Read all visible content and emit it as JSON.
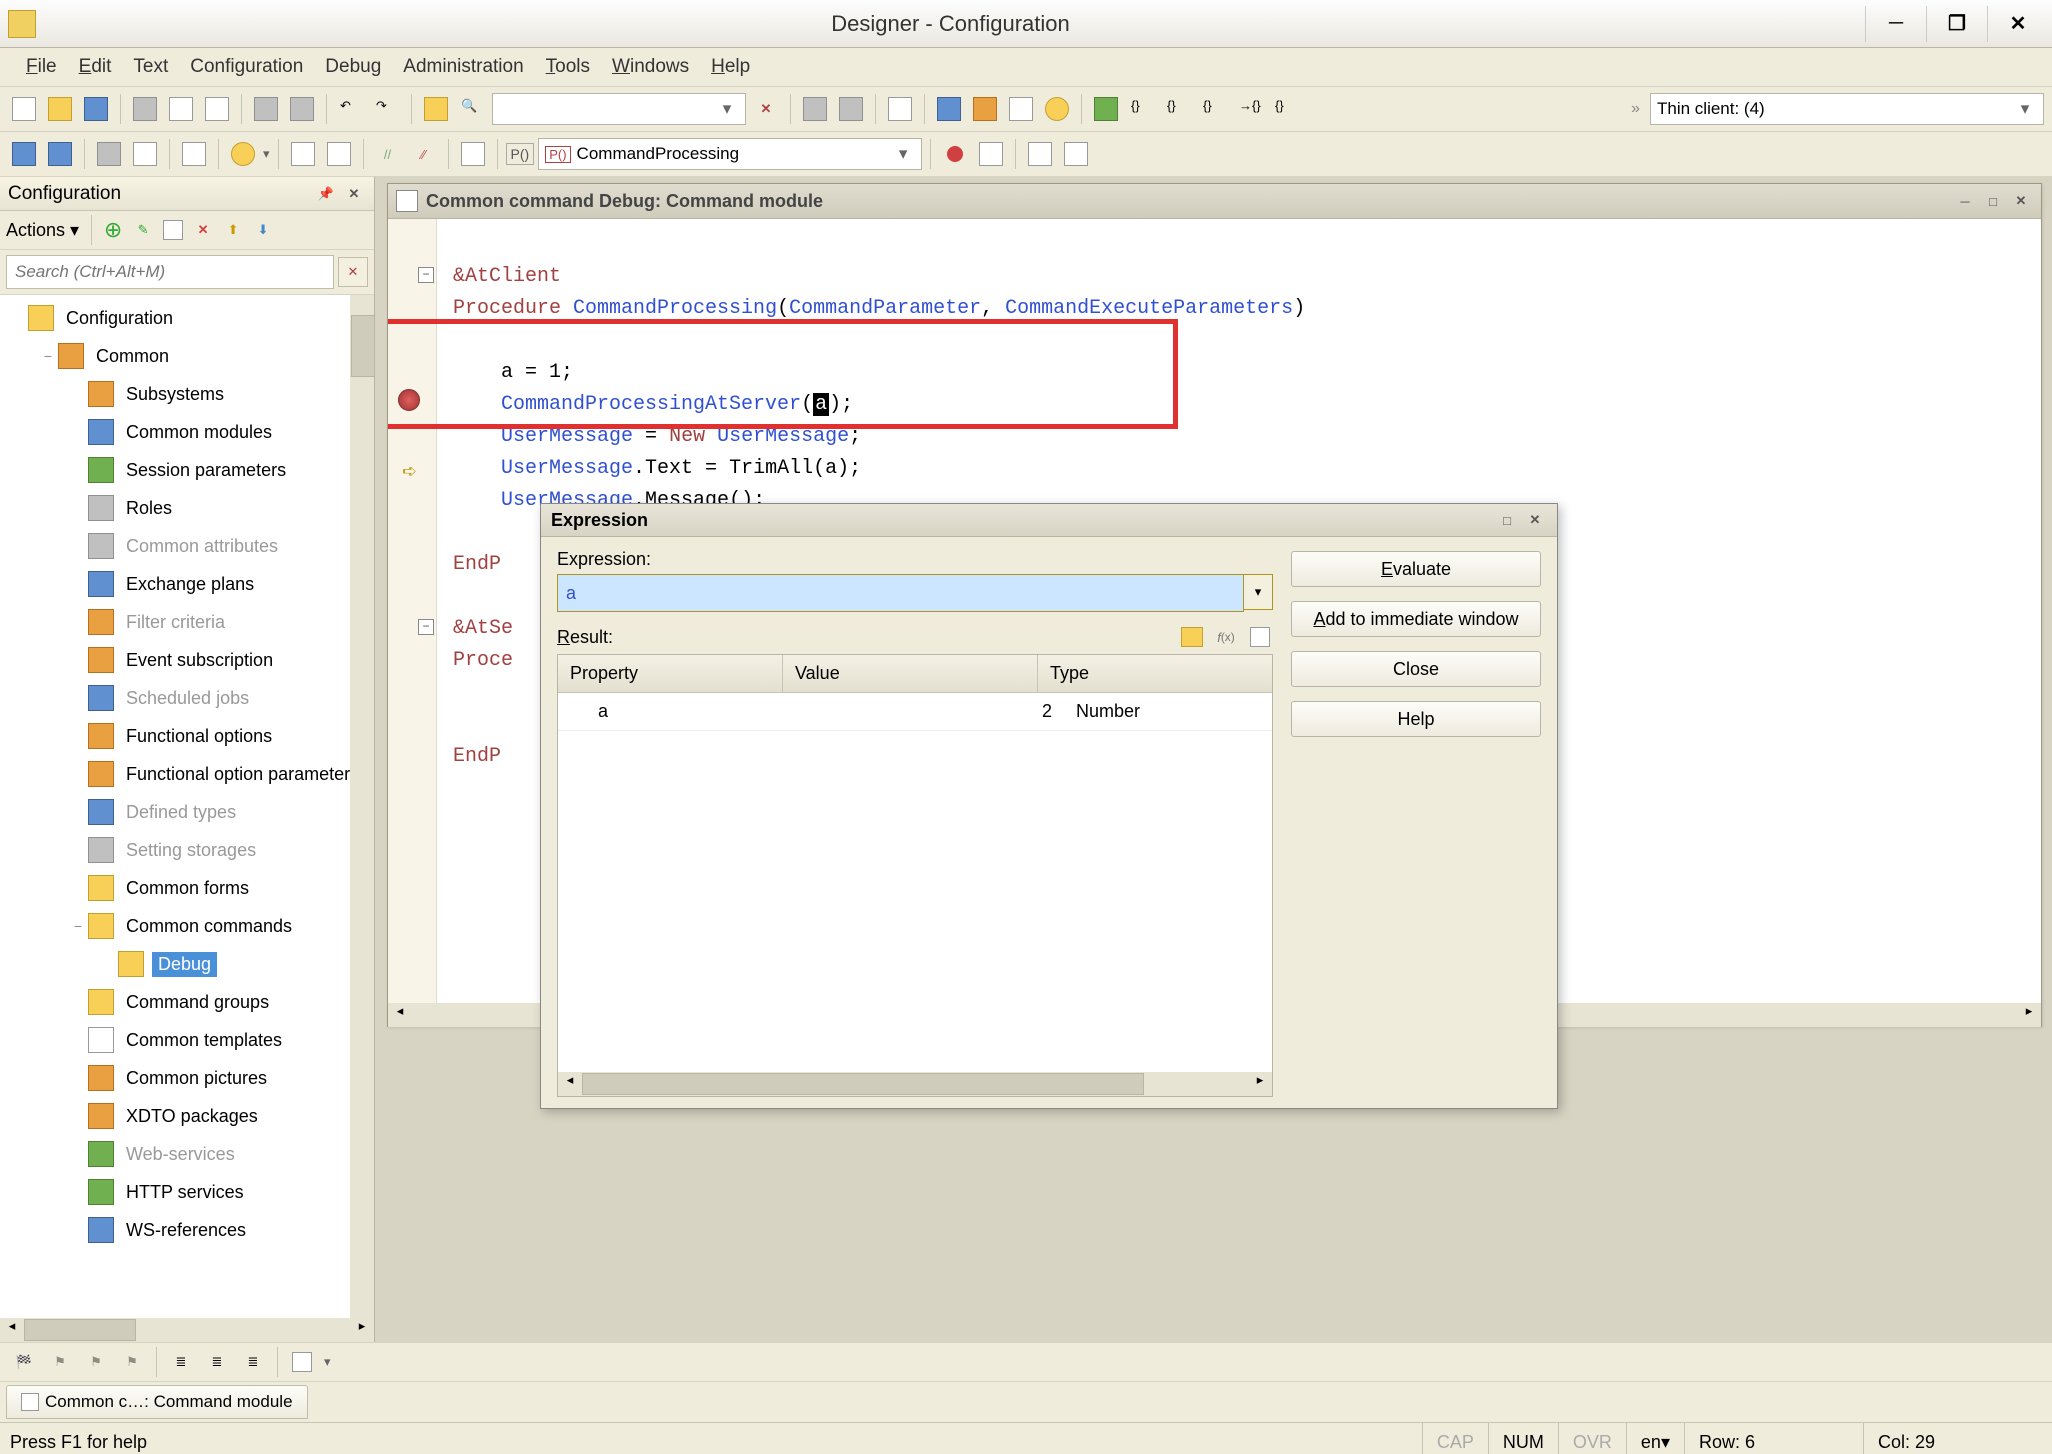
{
  "window": {
    "title": "Designer - Configuration"
  },
  "menus": {
    "file": "File",
    "edit": "Edit",
    "text": "Text",
    "configuration": "Configuration",
    "debug": "Debug",
    "administration": "Administration",
    "tools": "Tools",
    "windows": "Windows",
    "help": "Help"
  },
  "toolbar": {
    "thin_client": "Thin client: (4)"
  },
  "toolbar2": {
    "proc_combo": "CommandProcessing",
    "proc_prefix": "P()"
  },
  "config_panel": {
    "title": "Configuration",
    "actions": "Actions",
    "search_placeholder": "Search (Ctrl+Alt+M)",
    "tree": [
      {
        "label": "Configuration",
        "icon": "i-yellow",
        "indent": 0,
        "toggle": ""
      },
      {
        "label": "Common",
        "icon": "i-orange",
        "indent": 1,
        "toggle": "−"
      },
      {
        "label": "Subsystems",
        "icon": "i-orange",
        "indent": 2,
        "toggle": ""
      },
      {
        "label": "Common modules",
        "icon": "i-blue",
        "indent": 2,
        "toggle": ""
      },
      {
        "label": "Session parameters",
        "icon": "i-green",
        "indent": 2,
        "toggle": ""
      },
      {
        "label": "Roles",
        "icon": "i-gray",
        "indent": 2,
        "toggle": ""
      },
      {
        "label": "Common attributes",
        "icon": "i-gray",
        "indent": 2,
        "toggle": "",
        "dim": true
      },
      {
        "label": "Exchange plans",
        "icon": "i-blue",
        "indent": 2,
        "toggle": ""
      },
      {
        "label": "Filter criteria",
        "icon": "i-orange",
        "indent": 2,
        "toggle": "",
        "dim": true
      },
      {
        "label": "Event subscription",
        "icon": "i-orange",
        "indent": 2,
        "toggle": ""
      },
      {
        "label": "Scheduled jobs",
        "icon": "i-blue",
        "indent": 2,
        "toggle": "",
        "dim": true
      },
      {
        "label": "Functional options",
        "icon": "i-orange",
        "indent": 2,
        "toggle": ""
      },
      {
        "label": "Functional option parameters",
        "icon": "i-orange",
        "indent": 2,
        "toggle": ""
      },
      {
        "label": "Defined types",
        "icon": "i-blue",
        "indent": 2,
        "toggle": "",
        "dim": true
      },
      {
        "label": "Setting storages",
        "icon": "i-gray",
        "indent": 2,
        "toggle": "",
        "dim": true
      },
      {
        "label": "Common forms",
        "icon": "i-yellow",
        "indent": 2,
        "toggle": ""
      },
      {
        "label": "Common commands",
        "icon": "i-yellow",
        "indent": 2,
        "toggle": "−"
      },
      {
        "label": "Debug",
        "icon": "i-yellow",
        "indent": 3,
        "toggle": "",
        "selected": true
      },
      {
        "label": "Command groups",
        "icon": "i-yellow",
        "indent": 2,
        "toggle": ""
      },
      {
        "label": "Common templates",
        "icon": "i-white",
        "indent": 2,
        "toggle": ""
      },
      {
        "label": "Common pictures",
        "icon": "i-orange",
        "indent": 2,
        "toggle": ""
      },
      {
        "label": "XDTO packages",
        "icon": "i-orange",
        "indent": 2,
        "toggle": ""
      },
      {
        "label": "Web-services",
        "icon": "i-green",
        "indent": 2,
        "toggle": "",
        "dim": true
      },
      {
        "label": "HTTP services",
        "icon": "i-green",
        "indent": 2,
        "toggle": ""
      },
      {
        "label": "WS-references",
        "icon": "i-blue",
        "indent": 2,
        "toggle": ""
      }
    ]
  },
  "document": {
    "title": "Common command Debug: Command module",
    "code": {
      "l1_dir": "&AtClient",
      "l2_kw": "Procedure ",
      "l2_fn": "CommandProcessing",
      "l2_p1": "CommandParameter",
      "l2_sep": ", ",
      "l2_p2": "CommandExecuteParameters",
      "l4": "a = 1;",
      "l5_fn": "CommandProcessingAtServer",
      "l5_arg": "a",
      "l6_a": "UserMessage",
      "l6_b": " = ",
      "l6_new": "New ",
      "l6_c": "UserMessage",
      "l7_a": "UserMessage",
      "l7_b": ".Text = TrimAll(a);",
      "l8_a": "UserMessage",
      "l8_b": ".Message();",
      "l9": "EndP",
      "l11_dir": "&AtSe",
      "l12_kw": "Proce",
      "l15": "EndP"
    }
  },
  "expression_dialog": {
    "title": "Expression",
    "expr_label": "Expression:",
    "result_label": "Result:",
    "expr_value": "a",
    "buttons": {
      "evaluate": "Evaluate",
      "add_immediate": "Add to immediate window",
      "close": "Close",
      "help": "Help"
    },
    "grid": {
      "headers": {
        "property": "Property",
        "value": "Value",
        "type": "Type"
      },
      "rows": [
        {
          "property": "a",
          "value": "2",
          "type": "Number"
        }
      ]
    }
  },
  "tabbar": {
    "tab1": "Common c…: Command module"
  },
  "statusbar": {
    "hint": "Press F1 for help",
    "cap": "CAP",
    "num": "NUM",
    "ovr": "OVR",
    "lang": "en",
    "row": "Row: 6",
    "col": "Col: 29"
  }
}
